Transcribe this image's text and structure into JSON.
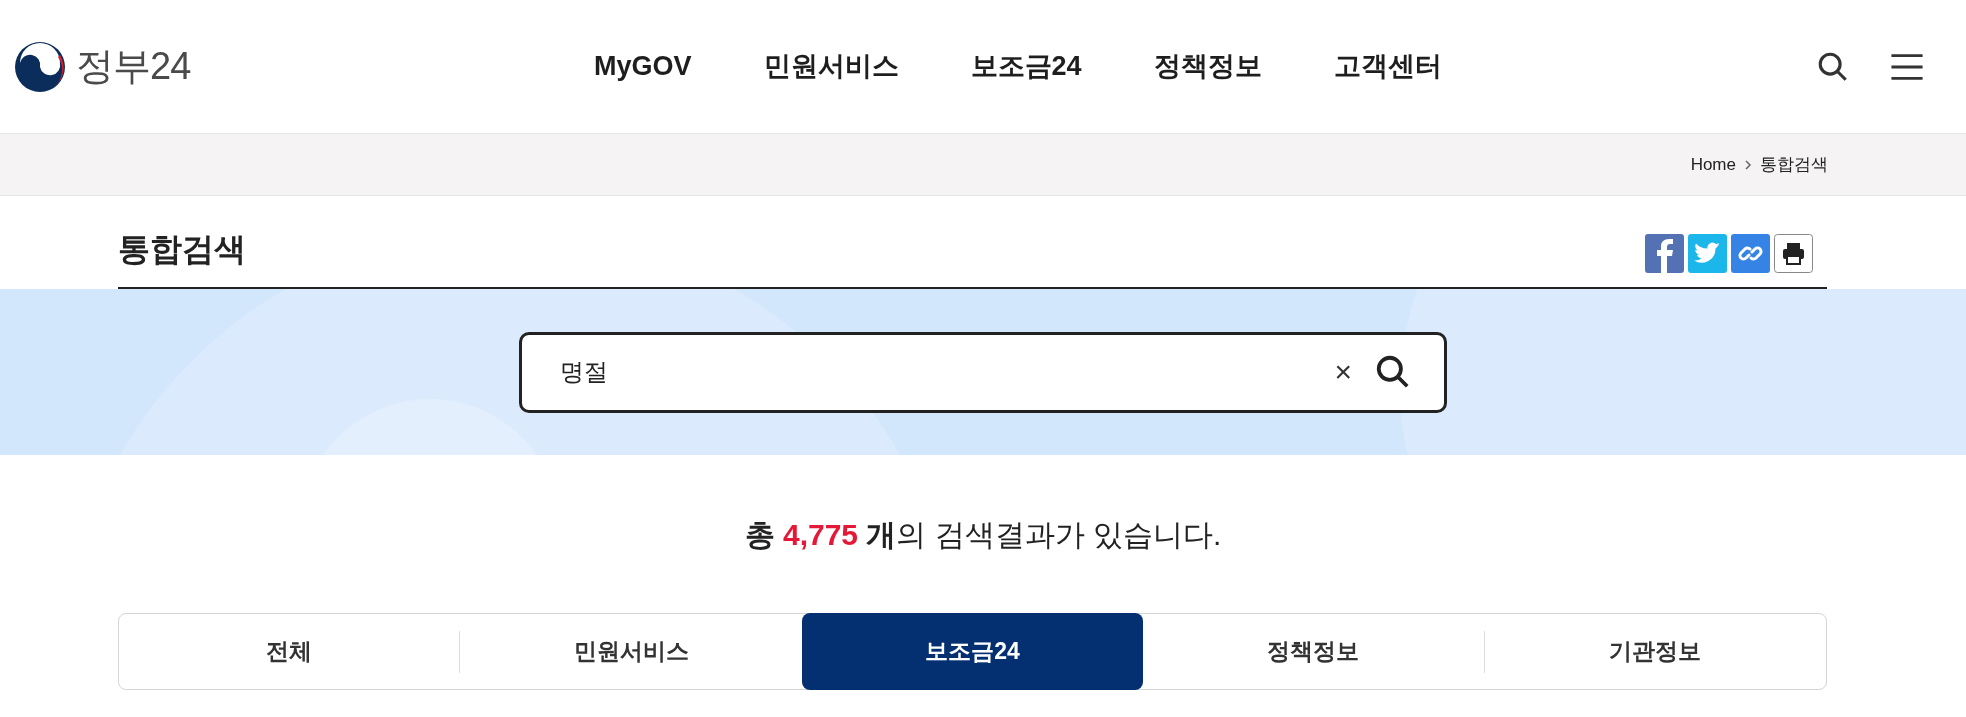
{
  "header": {
    "logo_text": "정부24",
    "nav": [
      "MyGOV",
      "민원서비스",
      "보조금24",
      "정책정보",
      "고객센터"
    ]
  },
  "breadcrumb": [
    "Home",
    "통합검색"
  ],
  "page_title": "통합검색",
  "search": {
    "value": "명절",
    "clear": "×"
  },
  "result_summary": {
    "prefix": "총",
    "count": "4,775",
    "unit": "개",
    "rest": "의 검색결과가 있습니다."
  },
  "tabs": [
    {
      "label": "전체",
      "selected": false
    },
    {
      "label": "민원서비스",
      "selected": false
    },
    {
      "label": "보조금24",
      "selected": true
    },
    {
      "label": "정책정보",
      "selected": false
    },
    {
      "label": "기관정보",
      "selected": false
    }
  ]
}
